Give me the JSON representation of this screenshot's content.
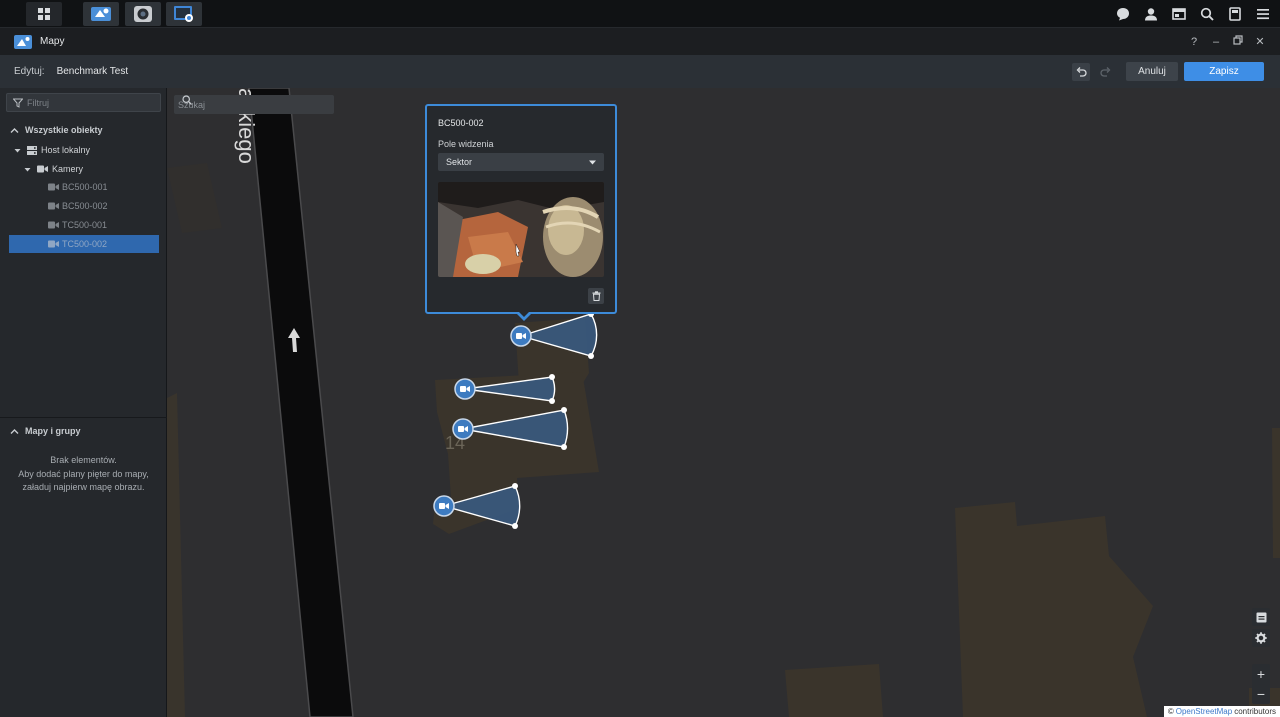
{
  "window": {
    "title": "Mapy"
  },
  "editbar": {
    "label": "Edytuj:",
    "value": "Benchmark Test",
    "cancel_label": "Anuluj",
    "save_label": "Zapisz"
  },
  "sidebar": {
    "filter_placeholder": "Filtruj",
    "objects_header": "Wszystkie obiekty",
    "tree": [
      {
        "label": "Host lokalny"
      },
      {
        "label": "Kamery"
      },
      {
        "label": "BC500-001"
      },
      {
        "label": "BC500-002"
      },
      {
        "label": "TC500-001"
      },
      {
        "label": "TC500-002",
        "selected": true
      }
    ],
    "maps_header": "Mapy i grupy",
    "empty_line1": "Brak elementów.",
    "empty_line2": "Aby dodać plany pięter do mapy,",
    "empty_line3": "załaduj najpierw mapę obrazu."
  },
  "map": {
    "search_placeholder": "Szukaj",
    "street_label": "ackiego",
    "building_number": "14",
    "attribution_prefix": "©",
    "attribution_link": "OpenStreetMap",
    "attribution_suffix": "contributors"
  },
  "popup": {
    "camera_name": "BC500-002",
    "fov_label": "Pole widzenia",
    "fov_value": "Sektor"
  },
  "colors": {
    "accent": "#3e8ee6",
    "selection": "#2f68ae",
    "camera_marker": "#3d7bc0"
  }
}
